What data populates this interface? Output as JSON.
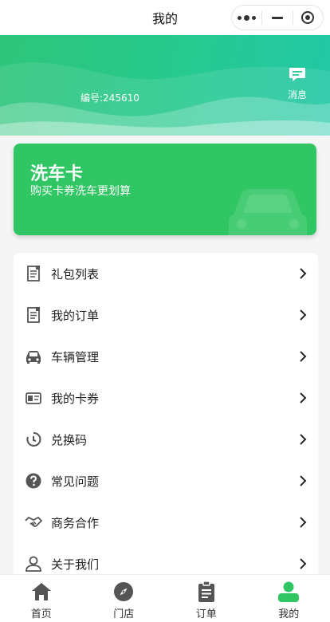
{
  "page": {
    "title": "我的"
  },
  "header": {
    "user_id": "编号:245610",
    "message_label": "消息"
  },
  "card": {
    "title": "洗车卡",
    "subtitle": "购买卡券洗车更划算"
  },
  "menu": {
    "items": [
      {
        "label": "礼包列表",
        "icon": "document-icon"
      },
      {
        "label": "我的订单",
        "icon": "document-icon"
      },
      {
        "label": "车辆管理",
        "icon": "car-icon"
      },
      {
        "label": "我的卡券",
        "icon": "card-icon"
      },
      {
        "label": "兑换码",
        "icon": "refresh-icon"
      },
      {
        "label": "常见问题",
        "icon": "question-icon"
      },
      {
        "label": "商务合作",
        "icon": "handshake-icon"
      },
      {
        "label": "关于我们",
        "icon": "user-icon"
      }
    ]
  },
  "tabbar": {
    "items": [
      {
        "label": "首页",
        "icon": "home-icon"
      },
      {
        "label": "门店",
        "icon": "compass-icon"
      },
      {
        "label": "订单",
        "icon": "clipboard-icon"
      },
      {
        "label": "我的",
        "icon": "profile-icon"
      }
    ],
    "active_index": 3
  },
  "colors": {
    "brand_green": "#2fc663",
    "hero_start": "#2ec57a",
    "hero_end": "#22c7a6",
    "icon_gray": "#555555"
  }
}
